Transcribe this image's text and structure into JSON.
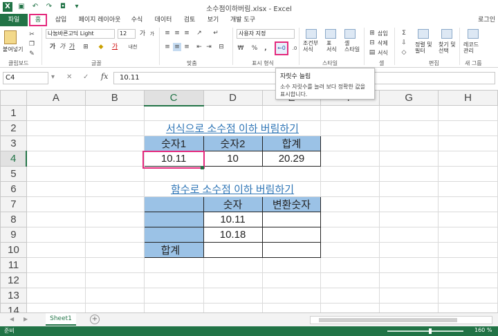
{
  "window": {
    "title": "소수점이하버림.xlsx - Excel"
  },
  "tabs": [
    {
      "label": "파일"
    },
    {
      "label": "홈"
    },
    {
      "label": "삽입"
    },
    {
      "label": "페이지 레이아웃"
    },
    {
      "label": "수식"
    },
    {
      "label": "데이터"
    },
    {
      "label": "검토"
    },
    {
      "label": "보기"
    },
    {
      "label": "개발 도구"
    }
  ],
  "user": {
    "login": "로그인"
  },
  "ribbon": {
    "clipboard": {
      "paste": "붙여넣기",
      "label": "클립보드"
    },
    "font": {
      "name": "나눔바른고딕 Light",
      "size": "12",
      "label": "글꼴",
      "bold": "가",
      "italic": "가",
      "underline": "가",
      "grow": "가",
      "shrink": "가",
      "color_glyph": "가",
      "phonetic": "내천"
    },
    "alignment": {
      "label": "맞춤"
    },
    "number": {
      "format": "사용자 지정",
      "label": "표시 형식",
      "percent": "%",
      "comma": ","
    },
    "styles": {
      "conditional": "조건부\n서식",
      "table": "표\n서식",
      "cell": "셀\n스타일",
      "label": "스타일"
    },
    "cells": {
      "insert": "삽입",
      "delete": "삭제",
      "format": "서식",
      "label": "셀"
    },
    "editing": {
      "sort": "정렬 및\n필터",
      "find": "찾기 및\n선택",
      "label": "편집"
    },
    "macro": {
      "record": "레코드\n관리",
      "label": "새 그룹"
    }
  },
  "tooltip": {
    "title": "자릿수 늘림",
    "description": "소수 자릿수를 늘려 보다 정확한 값을 표시합니다."
  },
  "formula_bar": {
    "name_box": "C4",
    "value": "10.11",
    "cancel": "✕",
    "enter": "✓",
    "fx": "fx"
  },
  "sheet": {
    "columns": [
      "A",
      "B",
      "C",
      "D",
      "E",
      "F",
      "G",
      "H"
    ],
    "rows": [
      "1",
      "2",
      "3",
      "4",
      "5",
      "6",
      "7",
      "8",
      "9",
      "10",
      "11",
      "12",
      "13",
      "14"
    ],
    "title1": "서식으로 소수점 이하 버림하기",
    "table1": {
      "headers": [
        "숫자1",
        "숫자2",
        "합계"
      ],
      "values": [
        "10.11",
        "10",
        "20.29"
      ]
    },
    "title2": "함수로 소수점 이하 버림하기",
    "table2": {
      "headers": [
        "숫자",
        "변환숫자"
      ],
      "r8": "10.11",
      "r9": "10.18",
      "sum_label": "합계"
    }
  },
  "sheet_tabs": {
    "active": "Sheet1",
    "add": "+"
  },
  "status": {
    "text": "준비",
    "zoom": "160 %"
  },
  "colors": {
    "accent": "#217346",
    "highlight": "#e4287c",
    "table_fill": "#9bc2e6",
    "title_text": "#2e75b6"
  },
  "icons": [
    "save-icon",
    "undo-icon",
    "redo-icon",
    "camera-icon",
    "paste-icon",
    "increase-decimal-icon",
    "decrease-decimal-icon",
    "add-sheet-icon"
  ]
}
